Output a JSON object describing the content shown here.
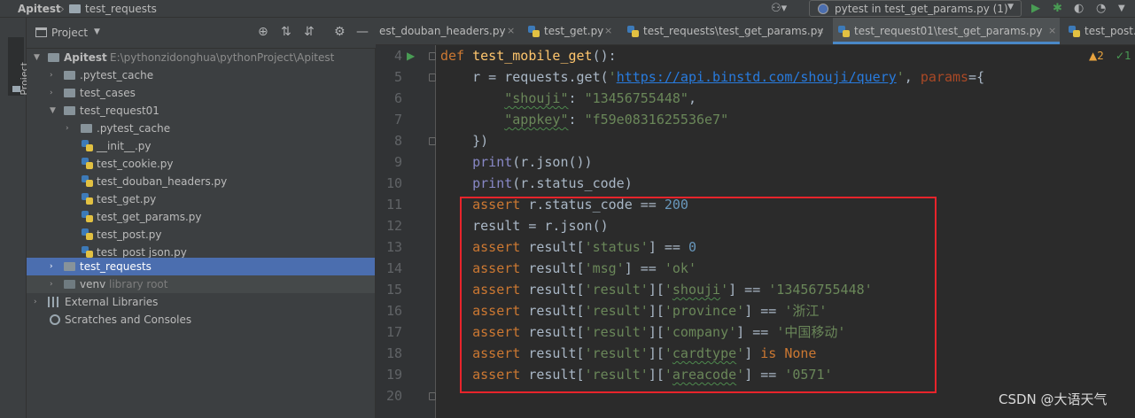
{
  "navbar": {
    "project_name": "Apitest",
    "separator": "›",
    "current_folder": "test_requests",
    "user_icon": "user-icon",
    "run_config": "pytest in test_get_params.py (1)",
    "run_config_arrow": "▼",
    "run_icon": "▶",
    "debug_icon": "✱",
    "coverage_icon": "◐",
    "profile_icon": "◔",
    "more_icon": "▼"
  },
  "left_stripe": {
    "tab_label": "Project"
  },
  "project_panel": {
    "title": "Project",
    "dropdown": "▼",
    "locate_icon": "⊕",
    "expand_icon": "⇅",
    "collapse_icon": "⇵",
    "gear_icon": "⚙",
    "hide_icon": "—",
    "tree": [
      {
        "label": "Apitest",
        "path": "E:\\pythonzidonghua\\pythonProject\\Apitest",
        "expanded": "▼"
      },
      {
        "label": ".pytest_cache",
        "arrow": "›"
      },
      {
        "label": "test_cases",
        "arrow": "›"
      },
      {
        "label": "test_request01",
        "arrow": "▼"
      },
      {
        "label": ".pytest_cache",
        "arrow": "›"
      },
      {
        "label": "__init__.py"
      },
      {
        "label": "test_cookie.py"
      },
      {
        "label": "test_douban_headers.py"
      },
      {
        "label": "test_get.py"
      },
      {
        "label": "test_get_params.py"
      },
      {
        "label": "test_post.py"
      },
      {
        "label": "test_post json.py"
      },
      {
        "label": "test_requests",
        "arrow": "›"
      },
      {
        "label": "venv",
        "secondary": "library root",
        "arrow": "›"
      },
      {
        "label": "External Libraries",
        "arrow": "›"
      },
      {
        "label": "Scratches and Consoles"
      }
    ]
  },
  "tabs": [
    {
      "label": "est_douban_headers.py",
      "close": "×"
    },
    {
      "label": "test_get.py",
      "close": "×"
    },
    {
      "label": "test_requests\\test_get_params.py",
      "close": "×"
    },
    {
      "label": "test_request01\\test_get_params.py",
      "close": "×"
    },
    {
      "label": "test_post.py"
    }
  ],
  "editor": {
    "inspections_warn": "▲2",
    "inspections_ok": "✓1",
    "line_numbers": [
      "4",
      "5",
      "6",
      "7",
      "8",
      "9",
      "10",
      "11",
      "12",
      "13",
      "14",
      "15",
      "16",
      "17",
      "18",
      "19",
      "20"
    ],
    "code": {
      "l4_def": "def",
      "l4_fn": "test_mobile_get",
      "l4_rest": "():",
      "l5_a": "    r = requests.get(",
      "l5_q1": "'",
      "l5_url": "https://api.binstd.com/shouji/query",
      "l5_q2": "'",
      "l5_comma": ", ",
      "l5_param": "params",
      "l5_b": "={",
      "l6_indent": "        ",
      "l6_key": "\"shouji\"",
      "l6_colon": ": ",
      "l6_val": "\"13456755448\"",
      "l6_comma": ",",
      "l7_indent": "        ",
      "l7_key": "\"appkey\"",
      "l7_colon": ": ",
      "l7_val": "\"f59e0831625536e7\"",
      "l8": "    })",
      "l9_indent": "    ",
      "l9_print": "print",
      "l9_rest": "(r.json())",
      "l10_indent": "    ",
      "l10_print": "print",
      "l10_rest": "(r.status_code)",
      "l11_indent": "    ",
      "l11_assert": "assert",
      "l11_mid": " r.status_code == ",
      "l11_num": "200",
      "l12": "    result = r.json()",
      "l13_indent": "    ",
      "l13_assert": "assert",
      "l13_mid": " result[",
      "l13_key": "'status'",
      "l13_end": "] == ",
      "l13_num": "0",
      "l14_indent": "    ",
      "l14_assert": "assert",
      "l14_mid": " result[",
      "l14_key": "'msg'",
      "l14_end": "] == ",
      "l14_val": "'ok'",
      "l15_indent": "    ",
      "l15_assert": "assert",
      "l15_mid": " result[",
      "l15_k1": "'result'",
      "l15_b": "][",
      "l15_q1": "'",
      "l15_k2": "shouji",
      "l15_q2": "'",
      "l15_end": "] == ",
      "l15_val": "'13456755448'",
      "l16_indent": "    ",
      "l16_assert": "assert",
      "l16_mid": " result[",
      "l16_k1": "'result'",
      "l16_b": "][",
      "l16_k2": "'province'",
      "l16_end": "] == ",
      "l16_val": "'浙江'",
      "l17_indent": "    ",
      "l17_assert": "assert",
      "l17_mid": " result[",
      "l17_k1": "'result'",
      "l17_b": "][",
      "l17_k2": "'company'",
      "l17_end": "] == ",
      "l17_val": "'中国移动'",
      "l18_indent": "    ",
      "l18_assert": "assert",
      "l18_mid": " result[",
      "l18_k1": "'result'",
      "l18_b": "][",
      "l18_q1": "'",
      "l18_k2": "cardtype",
      "l18_q2": "'",
      "l18_end": "] ",
      "l18_is": "is",
      "l18_sp": " ",
      "l18_none": "None",
      "l19_indent": "    ",
      "l19_assert": "assert",
      "l19_mid": " result[",
      "l19_k1": "'result'",
      "l19_b": "][",
      "l19_q1": "'",
      "l19_k2": "areacode",
      "l19_q2": "'",
      "l19_end": "] == ",
      "l19_val": "'0571'"
    },
    "watermark": "CSDN @大语天气"
  },
  "colors": {
    "keyword": "#cc7832",
    "function": "#ffc66d",
    "string": "#6a8759",
    "number": "#6897bb",
    "selection": "#4b6eaf",
    "highlight_box": "#e8242b"
  }
}
